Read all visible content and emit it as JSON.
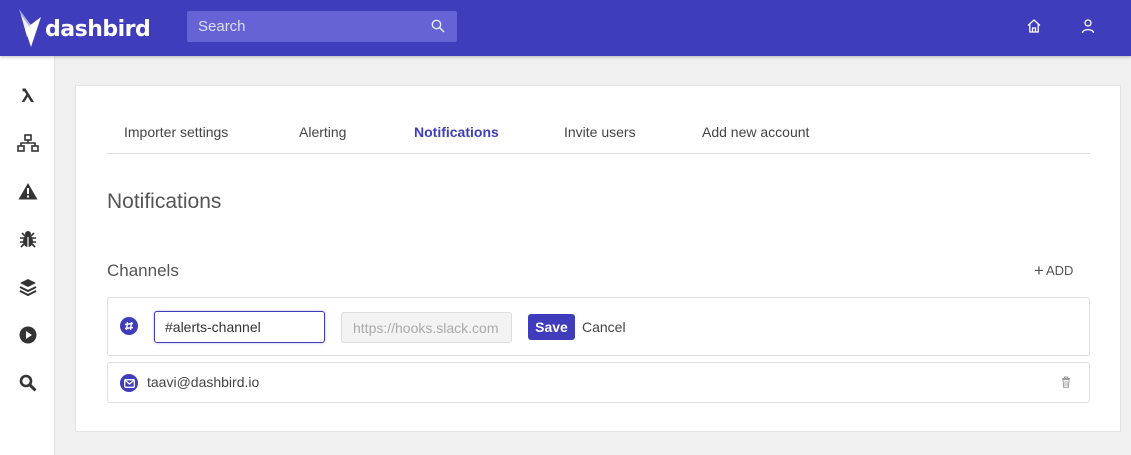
{
  "app": {
    "name": "dashbird"
  },
  "header": {
    "search_placeholder": "Search",
    "icons": [
      "dashbird-logo-icon",
      "search-icon",
      "home-icon",
      "user-icon"
    ]
  },
  "sidebar": {
    "items": [
      {
        "icon": "lambda-icon"
      },
      {
        "icon": "network-icon"
      },
      {
        "icon": "warning-icon"
      },
      {
        "icon": "bug-icon"
      },
      {
        "icon": "layers-icon"
      },
      {
        "icon": "play-icon"
      },
      {
        "icon": "search-icon"
      }
    ]
  },
  "tabs": [
    {
      "label": "Importer settings",
      "active": false
    },
    {
      "label": "Alerting",
      "active": false
    },
    {
      "label": "Notifications",
      "active": true
    },
    {
      "label": "Invite users",
      "active": false
    },
    {
      "label": "Add new account",
      "active": false
    }
  ],
  "page": {
    "title": "Notifications",
    "channels_title": "Channels",
    "add_label": "ADD"
  },
  "new_channel": {
    "type_icon": "slack-icon",
    "channel_value": "#alerts-channel",
    "webhook_placeholder": "https://hooks.slack.com",
    "save_label": "Save",
    "cancel_label": "Cancel"
  },
  "channels": [
    {
      "type_icon": "mail-icon",
      "value": "taavi@dashbird.io",
      "action_icon": "trash-icon"
    }
  ],
  "colors": {
    "brand": "#3f3dbb",
    "search_bg": "#6563d6",
    "background": "#f0f0f0"
  }
}
